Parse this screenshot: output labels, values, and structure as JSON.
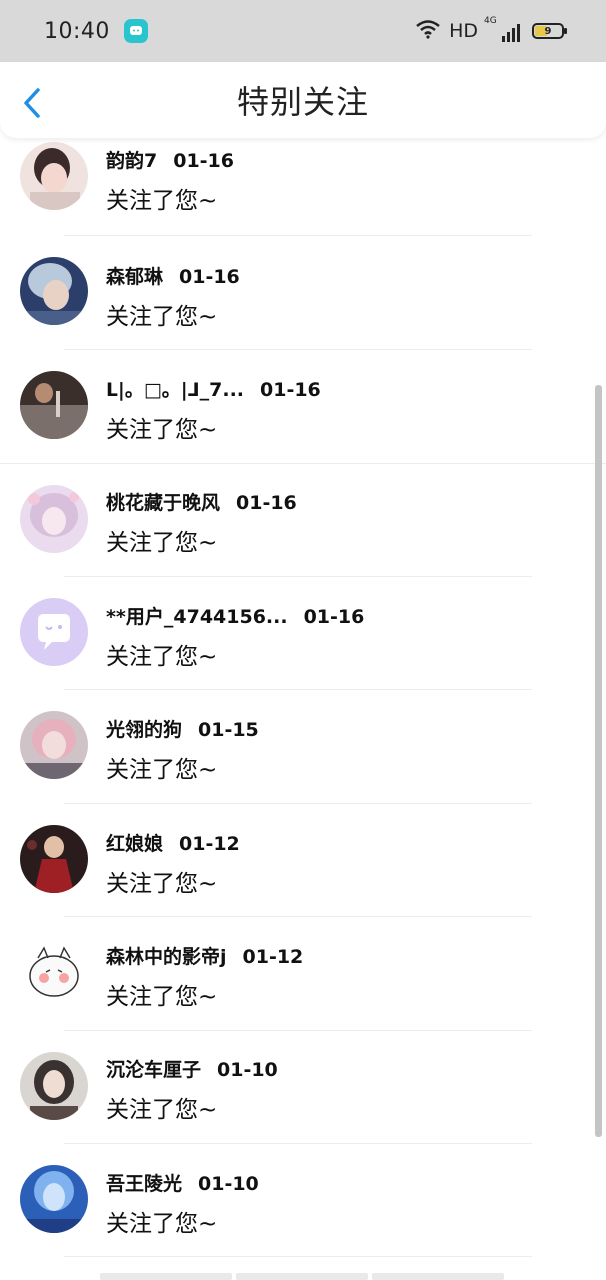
{
  "status_bar": {
    "time": "10:40",
    "network_label": "HD",
    "cell_label": "4G",
    "battery_level": "9"
  },
  "header": {
    "title": "特别关注",
    "back_icon": "chevron-left-icon",
    "accent_color": "#1f8fe6"
  },
  "list": {
    "items": [
      {
        "name": "韵韵7",
        "date": "01-16",
        "message": "关注了您~"
      },
      {
        "name": "森郁琳",
        "date": "01-16",
        "message": "关注了您~"
      },
      {
        "name": "ᒪ|。□。|ᒧ_7...",
        "date": "01-16",
        "message": "关注了您~"
      },
      {
        "name": "桃花藏于晚风",
        "date": "01-16",
        "message": "关注了您~"
      },
      {
        "name": "**用户_4744156...",
        "date": "01-16",
        "message": "关注了您~"
      },
      {
        "name": "光翎的狗",
        "date": "01-15",
        "message": "关注了您~"
      },
      {
        "name": "红娘娘",
        "date": "01-12",
        "message": "关注了您~"
      },
      {
        "name": "森林中的影帝j",
        "date": "01-12",
        "message": "关注了您~"
      },
      {
        "name": "沉沦车厘子",
        "date": "01-10",
        "message": "关注了您~"
      },
      {
        "name": "吾王陵光",
        "date": "01-10",
        "message": "关注了您~"
      }
    ]
  }
}
